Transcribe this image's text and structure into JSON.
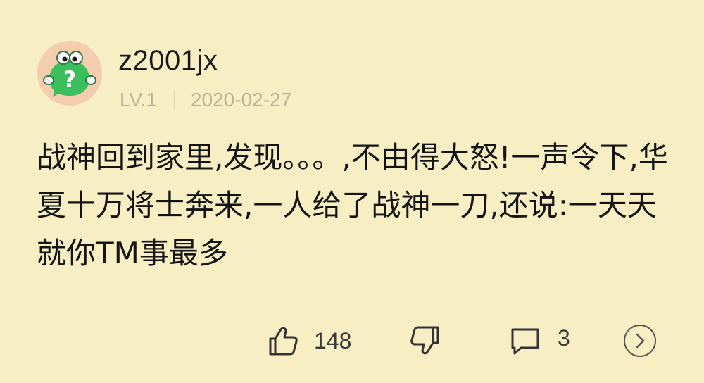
{
  "comment": {
    "username": "z2001jx",
    "level": "LV.1",
    "date": "2020-02-27",
    "text": "战神回到家里,发现。。。,不由得大怒!一声令下,华夏十万将士奔来,一人给了战神一刀,还说:一天天就你TM事最多"
  },
  "actions": {
    "like_count": "148",
    "comment_count": "3"
  },
  "icons": {
    "avatar": "question-mascot-avatar",
    "like": "thumbs-up-icon",
    "dislike": "thumbs-down-icon",
    "comment": "comment-bubble-icon",
    "more": "chevron-right-circle-icon"
  },
  "colors": {
    "background": "#f7eec4",
    "avatar_bg": "#f3cdae",
    "avatar_green": "#3bbf5e",
    "meta_text": "#b9b39a"
  }
}
